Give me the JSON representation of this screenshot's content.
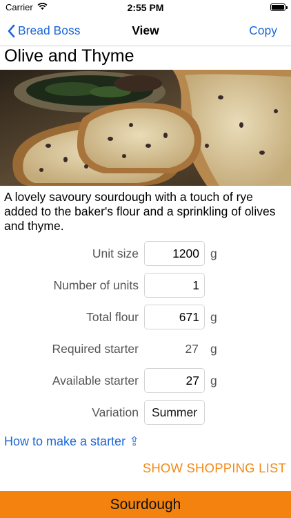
{
  "status_bar": {
    "carrier": "Carrier",
    "time": "2:55 PM"
  },
  "nav": {
    "back_label": "Bread Boss",
    "title": "View",
    "action_label": "Copy"
  },
  "recipe": {
    "title": "Olive and Thyme",
    "description": "A lovely savoury sourdough with a touch of rye added to the baker's flour and a sprinkling of olives and thyme."
  },
  "fields": {
    "unit_size": {
      "label": "Unit size",
      "value": "1200",
      "unit": "g"
    },
    "number_of_units": {
      "label": "Number of units",
      "value": "1"
    },
    "total_flour": {
      "label": "Total flour",
      "value": "671",
      "unit": "g"
    },
    "required_starter": {
      "label": "Required starter",
      "value": "27",
      "unit": "g"
    },
    "available_starter": {
      "label": "Available starter",
      "value": "27",
      "unit": "g"
    },
    "variation": {
      "label": "Variation",
      "value": "Summer"
    }
  },
  "links": {
    "starter": "How to make a starter ⇪",
    "shopping": "SHOW SHOPPING LIST"
  },
  "bottom_bar": {
    "label": "Sourdough"
  },
  "colors": {
    "link_blue": "#1a66d6",
    "accent_orange": "#f3820e",
    "shopping_orange": "#f28a17"
  }
}
